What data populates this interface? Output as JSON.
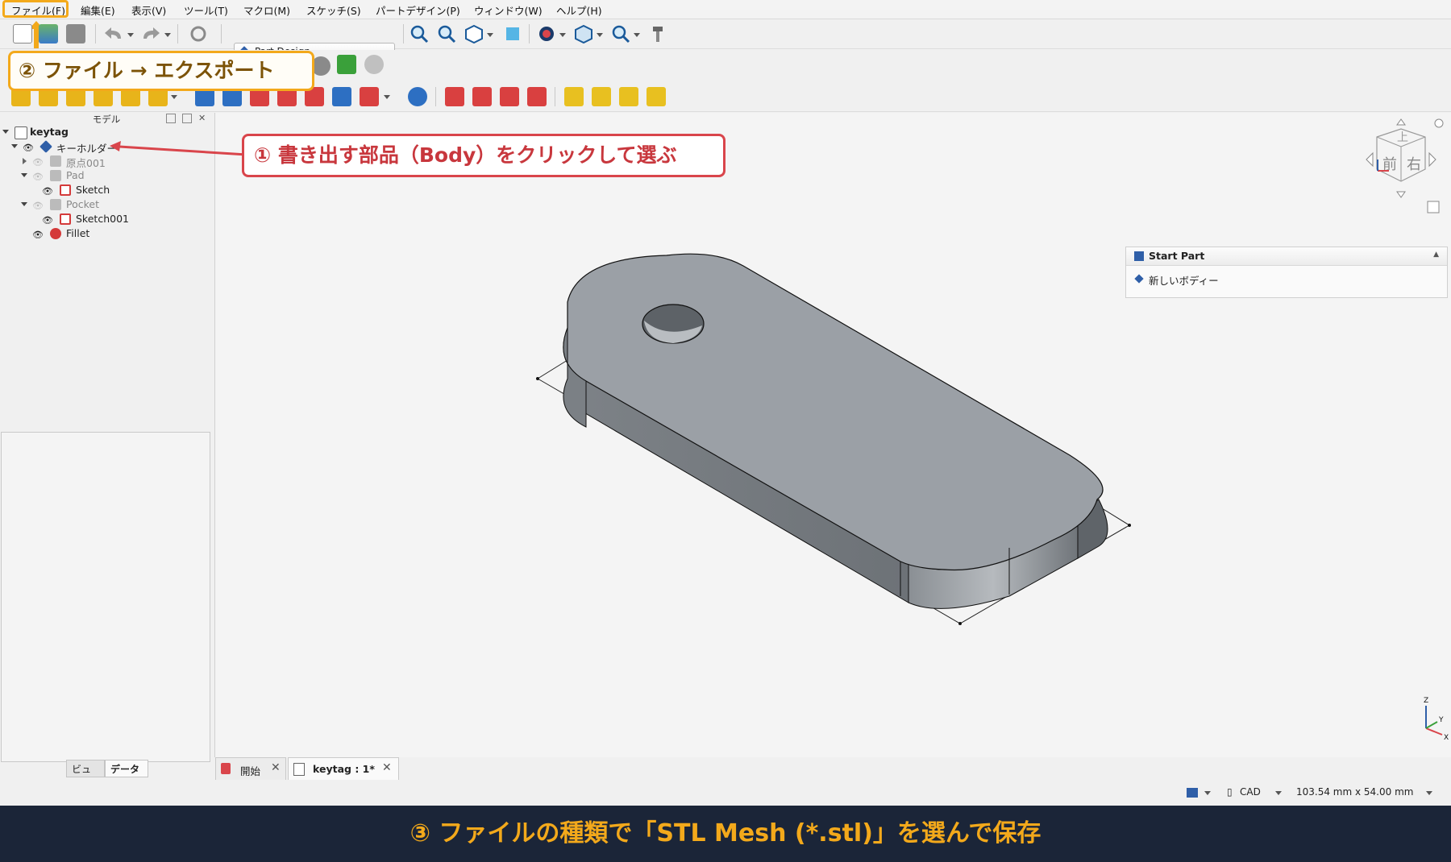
{
  "menu": {
    "items": [
      "ファイル(F)",
      "編集(E)",
      "表示(V)",
      "ツール(T)",
      "マクロ(M)",
      "スケッチ(S)",
      "パートデザイン(P)",
      "ウィンドウ(W)",
      "ヘルプ(H)"
    ]
  },
  "toolbar": {
    "workbench": "Part Design"
  },
  "left_panel": {
    "title": "モデル",
    "tree": [
      {
        "label": "keytag",
        "icon": "document-icon"
      },
      {
        "label": "キーホルダー",
        "icon": "body-icon"
      },
      {
        "label": "原点001",
        "icon": "origin-icon"
      },
      {
        "label": "Pad",
        "icon": "pad-icon"
      },
      {
        "label": "Sketch",
        "icon": "sketch-icon"
      },
      {
        "label": "Pocket",
        "icon": "pocket-icon"
      },
      {
        "label": "Sketch001",
        "icon": "sketch-icon"
      },
      {
        "label": "Fillet",
        "icon": "fillet-icon"
      }
    ],
    "tabs": [
      "ビュー",
      "データ"
    ]
  },
  "task_panel": {
    "title": "Start Part",
    "item": "新しいボディー"
  },
  "navcube": {
    "top": "上",
    "front": "前",
    "right": "右"
  },
  "axes": {
    "z": "Z",
    "y": "Y",
    "x": "X"
  },
  "doc_tabs": [
    {
      "label": "開始",
      "active": false
    },
    {
      "label": "keytag : 1*",
      "active": true
    }
  ],
  "status": {
    "nav_style": "CAD",
    "dimensions": "103.54 mm x 54.00 mm"
  },
  "annotations": {
    "step1": "① 書き出す部品（Body）をクリックして選ぶ",
    "step2": "② ファイル → エクスポート",
    "step3": "③ ファイルの種類で「STL Mesh (*.stl)」を選んで保存"
  },
  "colors": {
    "accent_orange": "#f3a91b",
    "accent_red": "#d9454b",
    "banner_bg": "#1b2538",
    "model_gray": "#9ba0a6"
  }
}
